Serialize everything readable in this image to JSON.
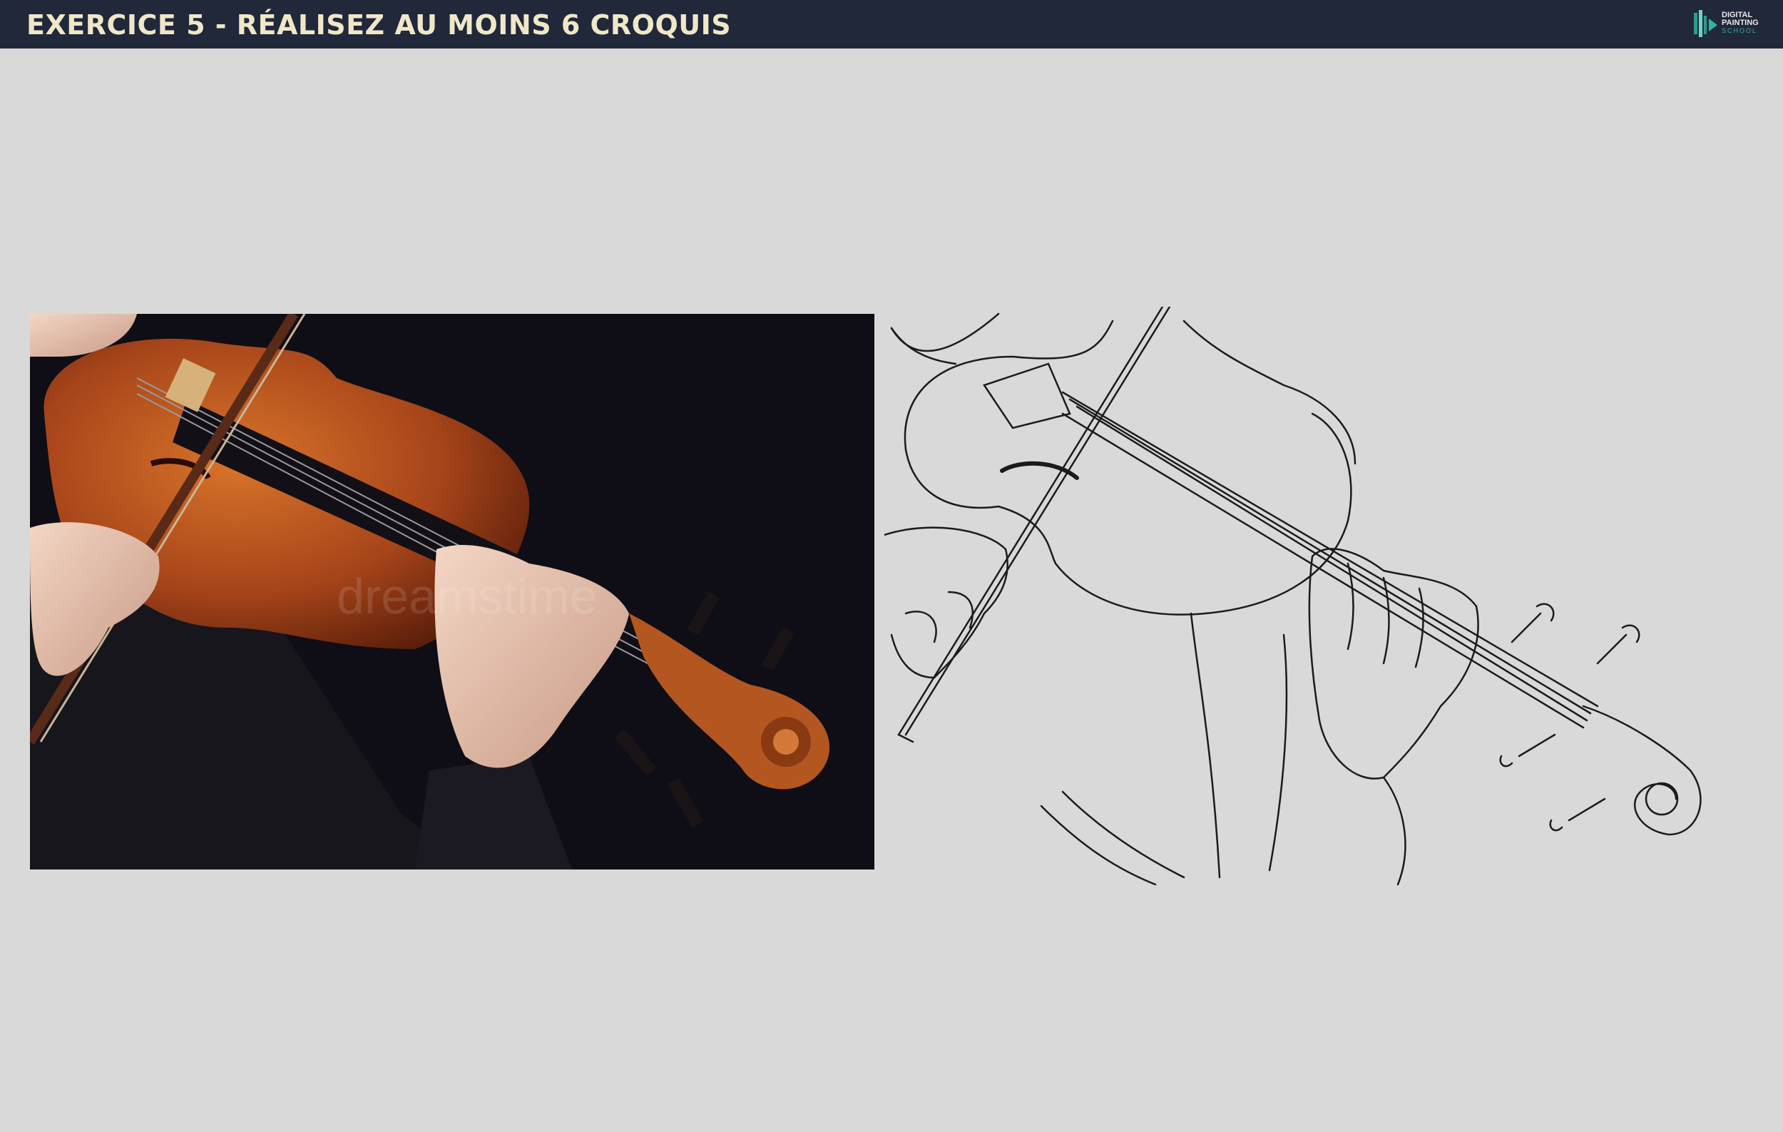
{
  "header": {
    "title": "EXERCICE 5 - RÉALISEZ AU MOINS 6 CROQUIS",
    "logo": {
      "line1": "DIGITAL",
      "line2": "PAINTING",
      "line3": "SCHOOL",
      "icon": "brush-logo-icon"
    }
  },
  "colors": {
    "header_bg": "#20283a",
    "title": "#f0e6c8",
    "canvas_bg": "#d9d9d9",
    "accent": "#34b3a2"
  },
  "photo": {
    "watermark": "dreamstime"
  }
}
